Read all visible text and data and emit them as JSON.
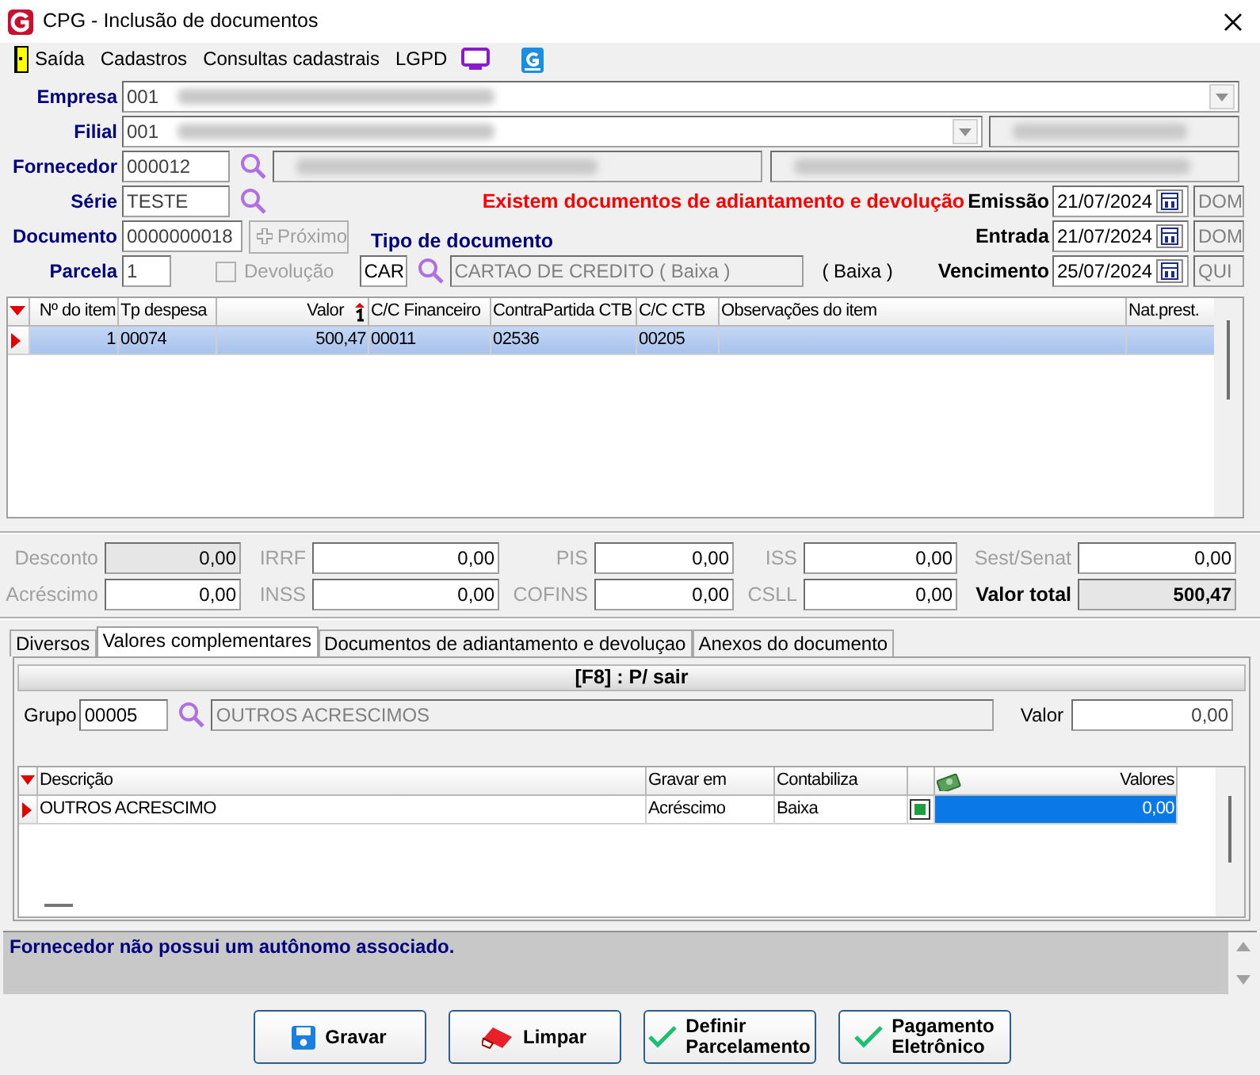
{
  "window": {
    "title": "CPG - Inclusão de documentos"
  },
  "menu": [
    {
      "label": "Saída",
      "kind": "door"
    },
    {
      "label": "Cadastros"
    },
    {
      "label": "Consultas cadastrais"
    },
    {
      "label": "LGPD"
    },
    {
      "kind": "monitor"
    },
    {
      "kind": "logo"
    }
  ],
  "empresa": {
    "label": "Empresa",
    "value": "001"
  },
  "filial": {
    "label": "Filial",
    "value": "001"
  },
  "fornecedor": {
    "label": "Fornecedor",
    "value": "000012"
  },
  "serie": {
    "label": "Série",
    "value": "TESTE"
  },
  "documento": {
    "label": "Documento",
    "value": "0000000018"
  },
  "proximo": {
    "label": "Próximo",
    "disabled": true
  },
  "parcela": {
    "label": "Parcela",
    "value": "1"
  },
  "devolucao": {
    "label": "Devolução",
    "checked": false,
    "disabled": true
  },
  "tipo_documento": {
    "label": "Tipo de documento",
    "code": "CAR",
    "description": "CARTAO DE CREDITO ( Baixa )",
    "note": "( Baixa )"
  },
  "warning": "Existem documentos de adiantamento e devolução",
  "dates": [
    {
      "label": "Emissão",
      "value": "21/07/2024",
      "weekday": "DOM"
    },
    {
      "label": "Entrada",
      "value": "21/07/2024",
      "weekday": "DOM"
    },
    {
      "label": "Vencimento",
      "value": "25/07/2024",
      "weekday": "QUI"
    }
  ],
  "items_grid": {
    "columns": [
      "Nº do item",
      "Tp despesa",
      "Valor",
      "C/C Financeiro",
      "ContraPartida CTB",
      "C/C CTB",
      "Observações do item",
      "Nat.prest."
    ],
    "rows": [
      {
        "cells": [
          "1",
          "00074",
          "500,47",
          "00011",
          "02536",
          "00205",
          "",
          ""
        ],
        "selected": true
      }
    ]
  },
  "totals": [
    {
      "label": "Desconto",
      "value": "0,00",
      "kind": "field",
      "readonly": true
    },
    {
      "label": "IRRF",
      "value": "0,00",
      "kind": "field",
      "readonly": false
    },
    {
      "label": "PIS",
      "value": "0,00",
      "kind": "field",
      "readonly": false
    },
    {
      "label": "ISS",
      "value": "0,00",
      "kind": "field",
      "readonly": false
    },
    {
      "label": "Sest/Senat",
      "value": "0,00",
      "kind": "field",
      "readonly": false
    },
    {
      "label": "Acréscimo",
      "value": "0,00",
      "kind": "field",
      "readonly": false
    },
    {
      "label": "INSS",
      "value": "0,00",
      "kind": "field",
      "readonly": false
    },
    {
      "label": "COFINS",
      "value": "0,00",
      "kind": "field",
      "readonly": false
    },
    {
      "label": "CSLL",
      "value": "0,00",
      "kind": "field",
      "readonly": false
    },
    {
      "label": "Valor total",
      "value": "500,47",
      "kind": "total",
      "readonly": true
    }
  ],
  "tabs": [
    {
      "label": "Diversos",
      "selected": false
    },
    {
      "label": "Valores complementares",
      "selected": true
    },
    {
      "label": "Documentos de adiantamento e devoluçao",
      "selected": false
    },
    {
      "label": "Anexos do documento",
      "selected": false
    }
  ],
  "panel": {
    "title": "[F8] : P/ sair",
    "grupo": {
      "label": "Grupo",
      "code": "00005",
      "description": "OUTROS ACRESCIMOS"
    },
    "valor": {
      "label": "Valor",
      "value": "0,00"
    },
    "grid": {
      "columns": [
        "Descrição",
        "Gravar em",
        "Contabiliza",
        "",
        "Valores"
      ],
      "rows": [
        {
          "descricao": "OUTROS ACRESCIMO",
          "gravar_em": "Acréscimo",
          "contabiliza": "Baixa",
          "checked": true,
          "valores": "0,00",
          "selected": true
        }
      ]
    }
  },
  "message": "Fornecedor não possui um autônomo associado.",
  "buttons": [
    {
      "lines": [
        "Gravar"
      ],
      "kind": "save"
    },
    {
      "lines": [
        "Limpar"
      ],
      "kind": "eraser"
    },
    {
      "lines": [
        "Definir",
        "Parcelamento"
      ],
      "kind": "check"
    },
    {
      "lines": [
        "Pagamento",
        "Eletrônico"
      ],
      "kind": "check"
    }
  ]
}
